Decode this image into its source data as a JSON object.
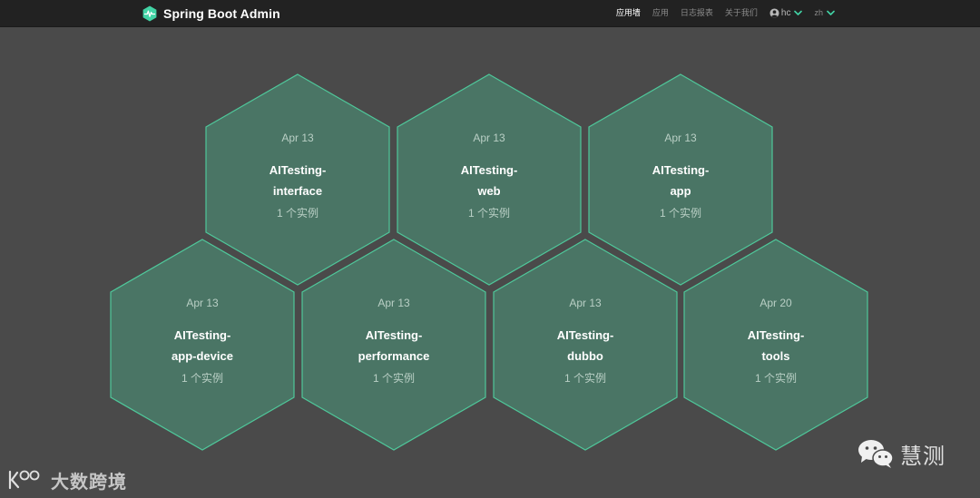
{
  "brand": {
    "name": "Spring Boot Admin",
    "logo_color": "#42d3a5"
  },
  "nav": {
    "items": [
      {
        "label": "应用墙",
        "active": true
      },
      {
        "label": "应用",
        "active": false
      },
      {
        "label": "日志报表",
        "active": false
      },
      {
        "label": "关于我们",
        "active": false
      }
    ],
    "user": "hc",
    "language": "zh"
  },
  "applications": [
    {
      "date": "Apr 13",
      "name_line1": "AITesting-",
      "name_line2": "interface",
      "instances": "1 个实例"
    },
    {
      "date": "Apr 13",
      "name_line1": "AITesting-",
      "name_line2": "web",
      "instances": "1 个实例"
    },
    {
      "date": "Apr 13",
      "name_line1": "AITesting-",
      "name_line2": "app",
      "instances": "1 个实例"
    },
    {
      "date": "Apr 13",
      "name_line1": "AITesting-",
      "name_line2": "app-device",
      "instances": "1 个实例"
    },
    {
      "date": "Apr 13",
      "name_line1": "AITesting-",
      "name_line2": "performance",
      "instances": "1 个实例"
    },
    {
      "date": "Apr 13",
      "name_line1": "AITesting-",
      "name_line2": "dubbo",
      "instances": "1 个实例"
    },
    {
      "date": "Apr 20",
      "name_line1": "AITesting-",
      "name_line2": "tools",
      "instances": "1 个实例"
    }
  ],
  "colors": {
    "background": "#4a4a4a",
    "navbar": "#222222",
    "hex_fill": "#4a7565",
    "hex_stroke": "#4fc79a",
    "accent": "#42d3a5"
  },
  "watermarks": {
    "left_text": "大数跨境",
    "right_text": "慧测"
  }
}
